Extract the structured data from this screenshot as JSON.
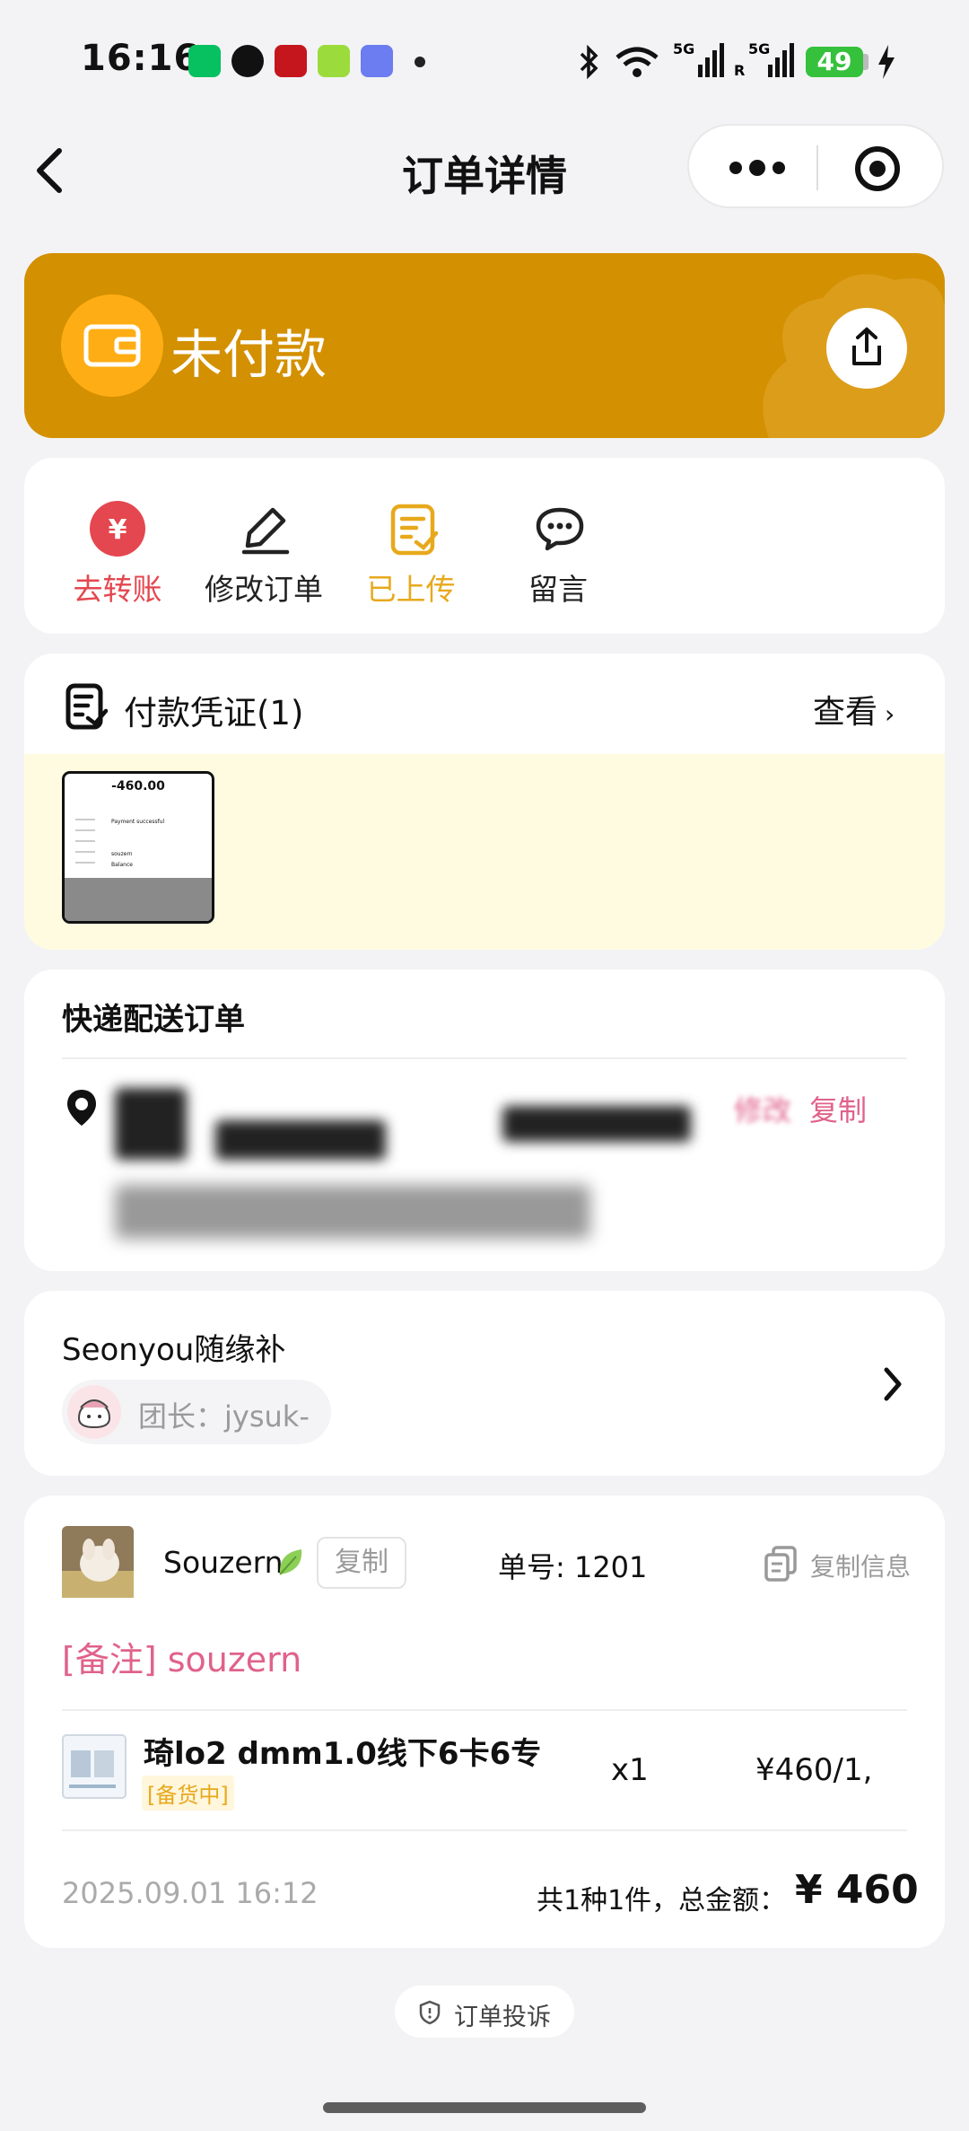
{
  "status_bar": {
    "time": "16:16",
    "battery": "49"
  },
  "nav": {
    "title": "订单详情"
  },
  "banner": {
    "status_text": "未付款"
  },
  "actions": [
    {
      "label": "去转账",
      "color": "#e4474f"
    },
    {
      "label": "修改订单",
      "color": "#222222"
    },
    {
      "label": "已上传",
      "color": "#e7a91c"
    },
    {
      "label": "留言",
      "color": "#222222"
    }
  ],
  "payment_proof": {
    "title": "付款凭证(1)",
    "view_label": "查看",
    "receipt": {
      "amount": "-460.00",
      "status": "Payment successful",
      "payee": "souzern",
      "method": "Balance"
    }
  },
  "delivery": {
    "title": "快递配送订单",
    "edit_label": "修改",
    "copy_label": "复制"
  },
  "group": {
    "name": "Seonyou随缘补",
    "leader": "团长：jysuk-"
  },
  "order": {
    "buyer": "Souzern",
    "copy_label": "复制",
    "order_no": "单号: 1201",
    "copy_info_label": "复制信息",
    "note": "[备注] souzern",
    "item": {
      "name": "琦lo2 dmm1.0线下6卡6专",
      "tag": "[备货中]",
      "qty": "x1",
      "price": "¥460/1,"
    },
    "date": "2025.09.01 16:12",
    "summary": "共1种1件，总金额：",
    "total": "¥ 460"
  },
  "complaint": {
    "label": "订单投诉"
  },
  "colors": {
    "banner": "#d39000",
    "accent_pink": "#e0628b",
    "upload_yellow": "#e7a91c",
    "background": "#f3f3f5"
  }
}
